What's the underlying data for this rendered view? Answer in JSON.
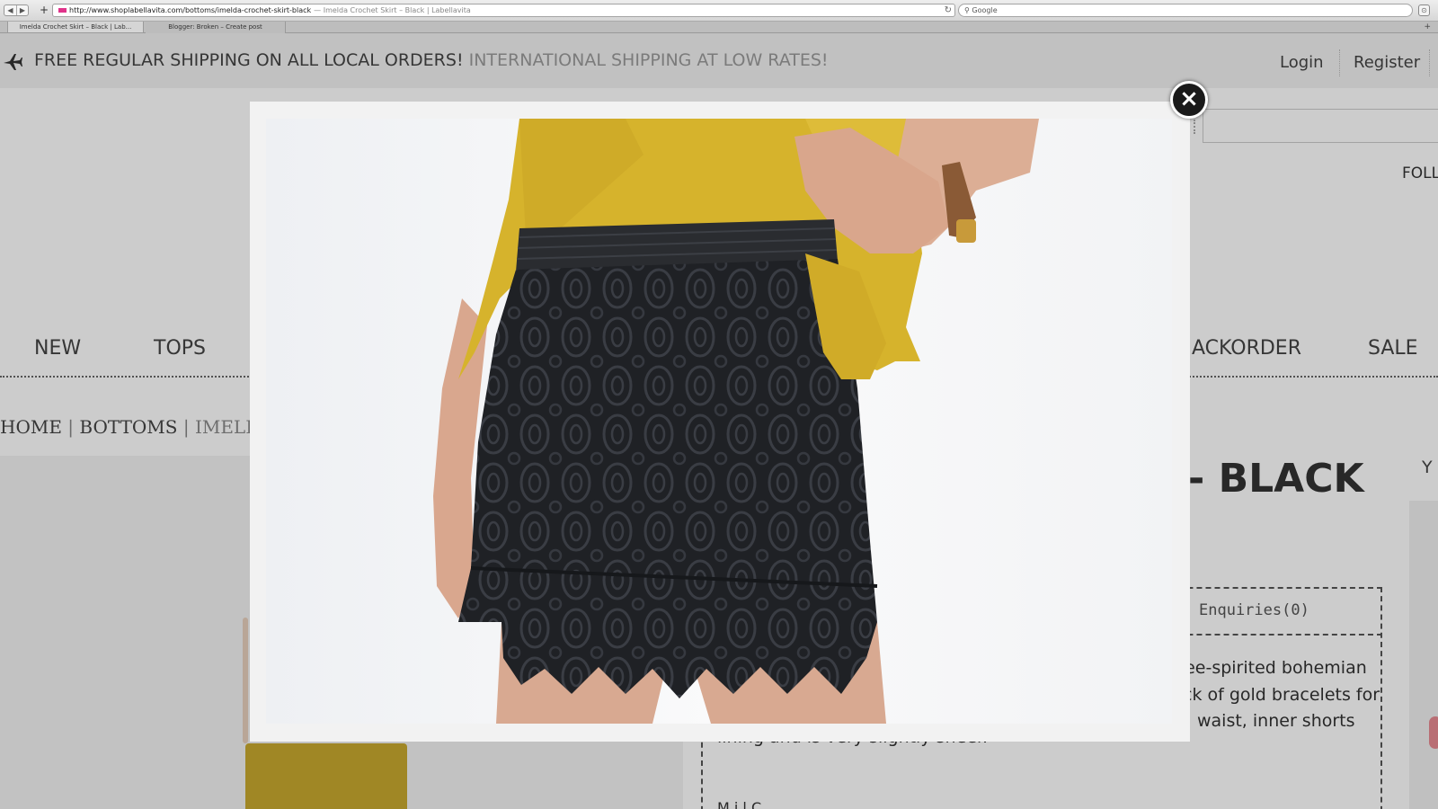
{
  "browser": {
    "url": "http://www.shoplabellavita.com/bottoms/imelda-crochet-skirt-black",
    "page_title": "— Imelda Crochet Skirt – Black | Labellavita",
    "search_placeholder": "Google",
    "tabs": [
      {
        "label": "Imelda Crochet Skirt – Black | Lab..."
      },
      {
        "label": "Blogger: Broken – Create post"
      }
    ],
    "icons": {
      "back": "◀",
      "forward": "▶",
      "new_tab": "+",
      "reload": "↻",
      "search": "⚲",
      "reader": "⊙",
      "tab_plus": "+"
    }
  },
  "header": {
    "promo_main": "FREE REGULAR SHIPPING ON ALL LOCAL ORDERS!",
    "promo_secondary": "INTERNATIONAL SHIPPING AT LOW RATES!",
    "login": "Login",
    "register": "Register",
    "follow_partial": "FOLL"
  },
  "nav": {
    "items": [
      {
        "label": "NEW"
      },
      {
        "label": "TOPS"
      },
      {
        "label": "ACKORDER"
      },
      {
        "label": "SALE"
      }
    ]
  },
  "breadcrumb": {
    "home": "HOME",
    "sep": "|",
    "bottoms": "BOTTOMS",
    "current": "IMELDA C"
  },
  "product": {
    "title_fragment": "- BLACK",
    "side_fragment": "Y",
    "enquiries": "Enquiries(0)",
    "desc_line1": "free-spirited bohemian",
    "desc_line2": "ck of gold bracelets for",
    "desc_line3": "waist, inner shorts",
    "desc_line4": "lining and is very slightly sheer.",
    "desc_more": "M   i l   C"
  },
  "modal": {
    "close_label": "×",
    "image_subject": "black crochet lace mini skirt with mustard chiffon top"
  },
  "colors": {
    "accent_mustard": "#D7B42E",
    "skirt_black": "#202226",
    "promo_text": "#444444",
    "promo_light": "#9A9A9A"
  }
}
